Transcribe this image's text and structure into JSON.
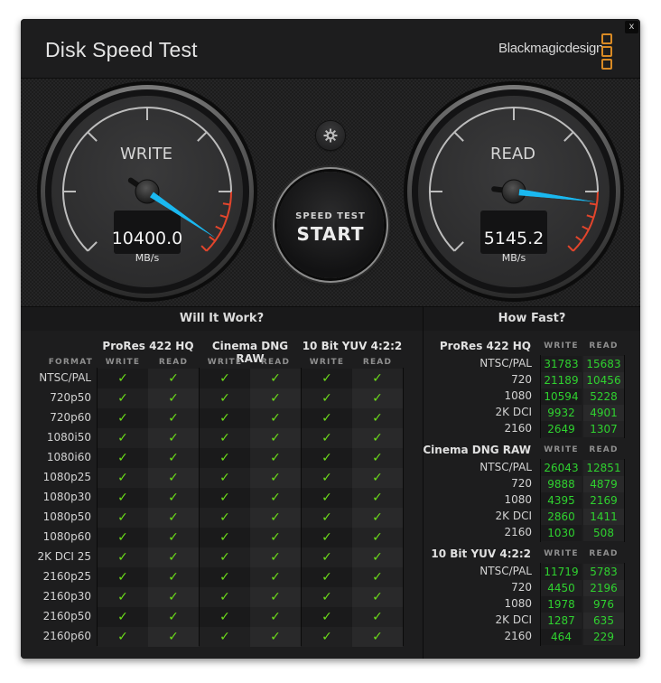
{
  "window": {
    "title": "Disk Speed Test",
    "brand": "Blackmagicdesign",
    "close_label": "x",
    "brand_color": "#d98a24"
  },
  "gauges": {
    "write": {
      "label": "WRITE",
      "value": "10400.0",
      "unit": "MB/s",
      "needle_fraction": 0.96
    },
    "read": {
      "label": "READ",
      "value": "5145.2",
      "unit": "MB/s",
      "needle_fraction": 0.86
    },
    "needle_color": "#1ab8f0",
    "redline_color": "#e2452c"
  },
  "controls": {
    "settings_icon": "gear-icon",
    "start_small": "SPEED TEST",
    "start_big": "START"
  },
  "will_it_work": {
    "title": "Will It Work?",
    "format_header": "FORMAT",
    "groups": [
      {
        "name": "ProRes 422 HQ",
        "columns": [
          "WRITE",
          "READ"
        ]
      },
      {
        "name": "Cinema DNG RAW",
        "columns": [
          "WRITE",
          "READ"
        ]
      },
      {
        "name": "10 Bit YUV 4:2:2",
        "columns": [
          "WRITE",
          "READ"
        ]
      }
    ],
    "check_glyph": "✓",
    "check_color": "#6cdc1a",
    "rows": [
      {
        "format": "NTSC/PAL",
        "results": [
          true,
          true,
          true,
          true,
          true,
          true
        ]
      },
      {
        "format": "720p50",
        "results": [
          true,
          true,
          true,
          true,
          true,
          true
        ]
      },
      {
        "format": "720p60",
        "results": [
          true,
          true,
          true,
          true,
          true,
          true
        ]
      },
      {
        "format": "1080i50",
        "results": [
          true,
          true,
          true,
          true,
          true,
          true
        ]
      },
      {
        "format": "1080i60",
        "results": [
          true,
          true,
          true,
          true,
          true,
          true
        ]
      },
      {
        "format": "1080p25",
        "results": [
          true,
          true,
          true,
          true,
          true,
          true
        ]
      },
      {
        "format": "1080p30",
        "results": [
          true,
          true,
          true,
          true,
          true,
          true
        ]
      },
      {
        "format": "1080p50",
        "results": [
          true,
          true,
          true,
          true,
          true,
          true
        ]
      },
      {
        "format": "1080p60",
        "results": [
          true,
          true,
          true,
          true,
          true,
          true
        ]
      },
      {
        "format": "2K DCI 25",
        "results": [
          true,
          true,
          true,
          true,
          true,
          true
        ]
      },
      {
        "format": "2160p25",
        "results": [
          true,
          true,
          true,
          true,
          true,
          true
        ]
      },
      {
        "format": "2160p30",
        "results": [
          true,
          true,
          true,
          true,
          true,
          true
        ]
      },
      {
        "format": "2160p50",
        "results": [
          true,
          true,
          true,
          true,
          true,
          true
        ]
      },
      {
        "format": "2160p60",
        "results": [
          true,
          true,
          true,
          true,
          true,
          true
        ]
      }
    ]
  },
  "how_fast": {
    "title": "How Fast?",
    "write_header": "WRITE",
    "read_header": "READ",
    "value_color": "#2fd22f",
    "groups": [
      {
        "name": "ProRes 422 HQ",
        "rows": [
          {
            "label": "NTSC/PAL",
            "write": "31783",
            "read": "15683"
          },
          {
            "label": "720",
            "write": "21189",
            "read": "10456"
          },
          {
            "label": "1080",
            "write": "10594",
            "read": "5228"
          },
          {
            "label": "2K DCI",
            "write": "9932",
            "read": "4901"
          },
          {
            "label": "2160",
            "write": "2649",
            "read": "1307"
          }
        ]
      },
      {
        "name": "Cinema DNG RAW",
        "rows": [
          {
            "label": "NTSC/PAL",
            "write": "26043",
            "read": "12851"
          },
          {
            "label": "720",
            "write": "9888",
            "read": "4879"
          },
          {
            "label": "1080",
            "write": "4395",
            "read": "2169"
          },
          {
            "label": "2K DCI",
            "write": "2860",
            "read": "1411"
          },
          {
            "label": "2160",
            "write": "1030",
            "read": "508"
          }
        ]
      },
      {
        "name": "10 Bit YUV 4:2:2",
        "rows": [
          {
            "label": "NTSC/PAL",
            "write": "11719",
            "read": "5783"
          },
          {
            "label": "720",
            "write": "4450",
            "read": "2196"
          },
          {
            "label": "1080",
            "write": "1978",
            "read": "976"
          },
          {
            "label": "2K DCI",
            "write": "1287",
            "read": "635"
          },
          {
            "label": "2160",
            "write": "464",
            "read": "229"
          }
        ]
      }
    ]
  }
}
